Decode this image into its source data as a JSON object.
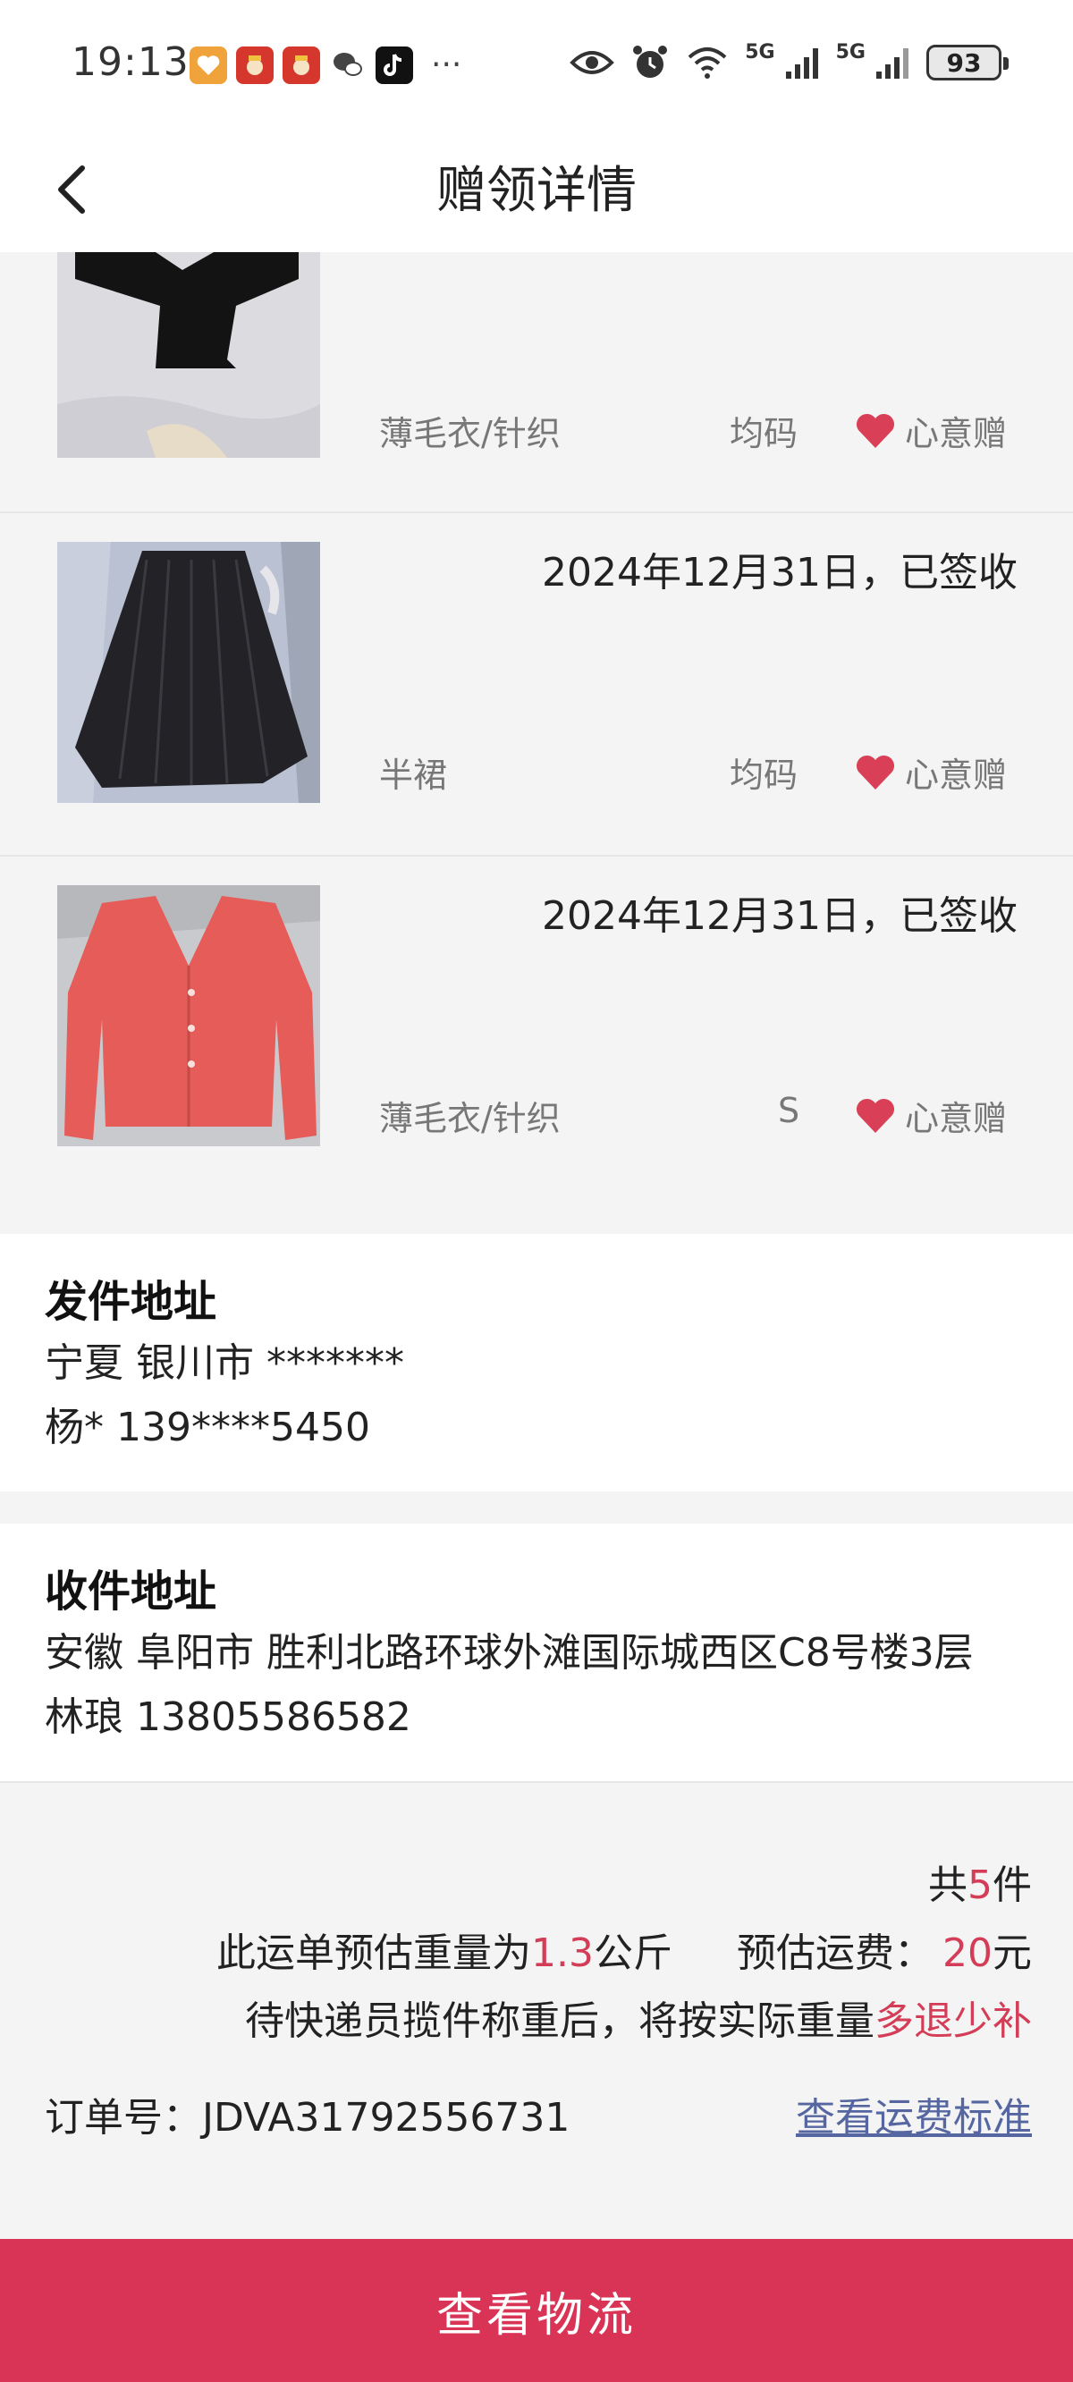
{
  "status_bar": {
    "time": "19:13",
    "more": "···",
    "net1": "5G",
    "net2": "5G",
    "battery": "93"
  },
  "header": {
    "title": "赠领详情"
  },
  "items": [
    {
      "date": "",
      "category": "薄毛衣/针织",
      "size": "均码",
      "gift_label": "心意赠",
      "photo_icon": "black-sweater-photo",
      "colors": {
        "bg": "#d9d8de",
        "garment": "#151515"
      }
    },
    {
      "date": "2024年12月31日，已签收",
      "category": "半裙",
      "size": "均码",
      "gift_label": "心意赠",
      "photo_icon": "black-pleated-skirt-photo",
      "colors": {
        "bg": "#b7bfd0",
        "garment": "#222226"
      }
    },
    {
      "date": "2024年12月31日，已签收",
      "category": "薄毛衣/针织",
      "size": "S",
      "gift_label": "心意赠",
      "photo_icon": "coral-cardigan-photo",
      "colors": {
        "bg": "#c8c9cc",
        "garment": "#e55d59"
      }
    }
  ],
  "sender": {
    "title": "发件地址",
    "address": "宁夏 银川市 *******",
    "contact": "杨* 139****5450"
  },
  "receiver": {
    "title": "收件地址",
    "address": "安徽 阜阳市 胜利北路环球外滩国际城西区C8号楼3层",
    "contact": "林琅 13805586582"
  },
  "summary": {
    "count_prefix": "共",
    "count": "5",
    "count_suffix": "件",
    "weight_prefix": "此运单预估重量为",
    "weight": "1.3",
    "weight_unit": "公斤",
    "fee_prefix": "预估运费：",
    "fee": "20",
    "fee_unit": "元",
    "note_prefix": "待快递员揽件称重后，将按实际重量",
    "note_highlight": "多退少补",
    "order_label": "订单号：JDVA31792556731",
    "rate_link": "查看运费标准"
  },
  "bottom_button": "查看物流",
  "colors": {
    "accent": "#d93455",
    "highlight_text": "#d43d57",
    "link": "#5566a0",
    "heart": "#d94058"
  }
}
